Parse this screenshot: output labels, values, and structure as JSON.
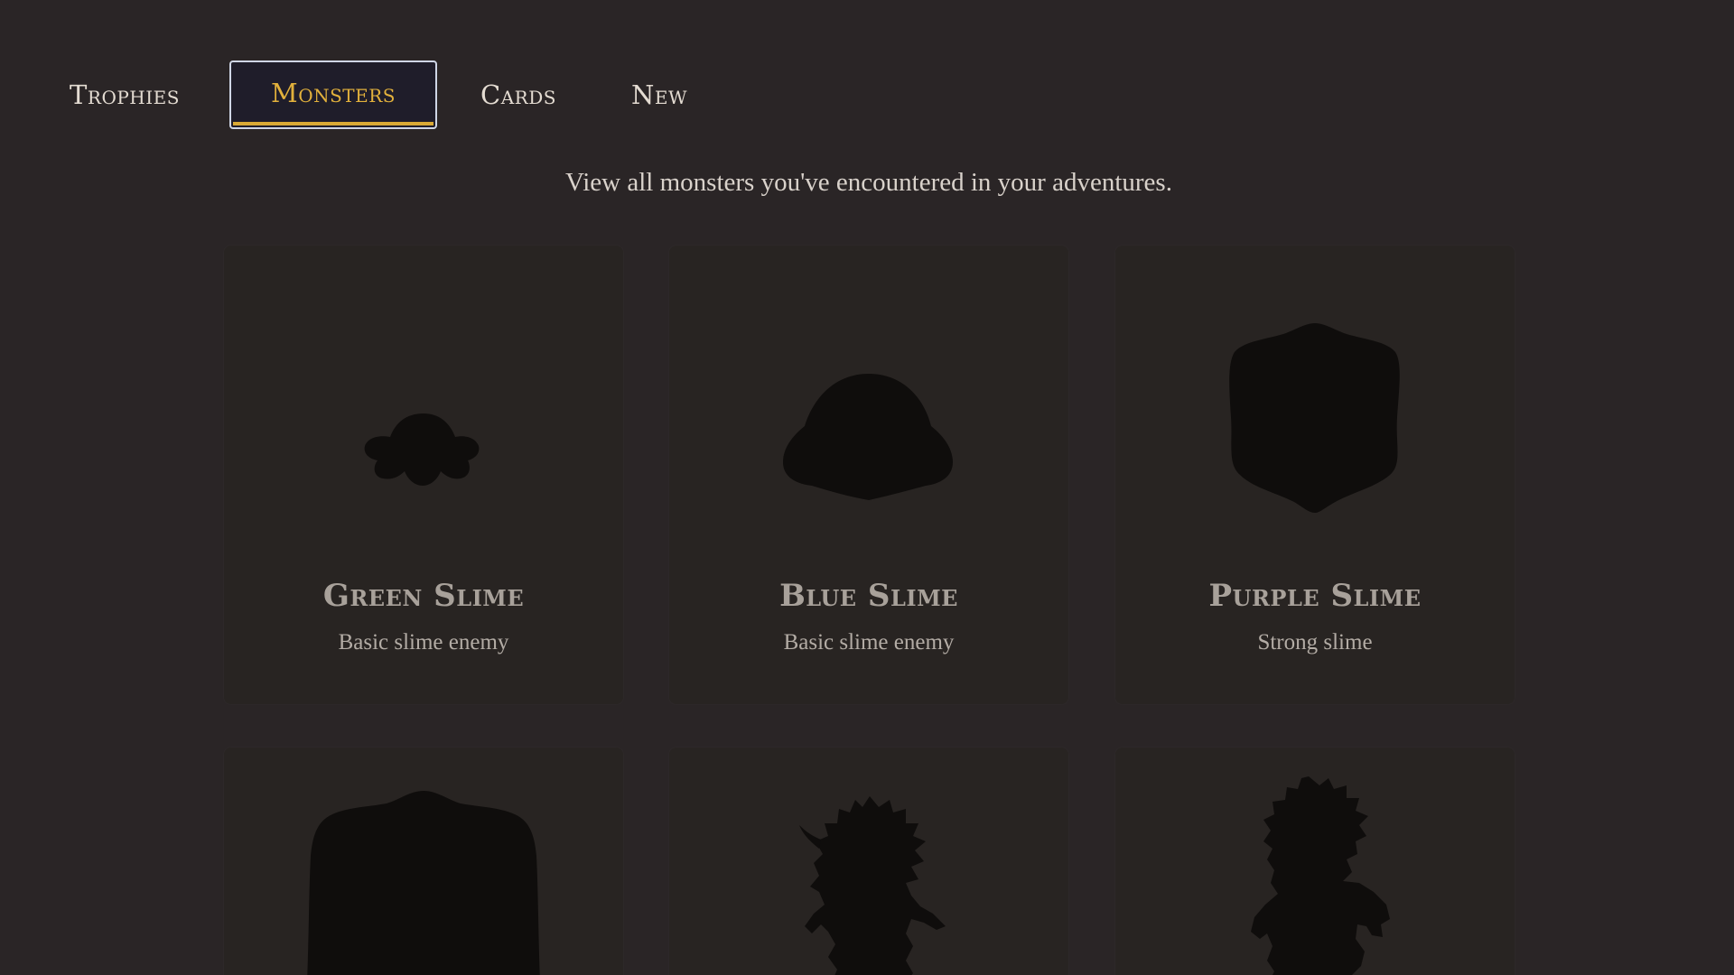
{
  "tabs": [
    {
      "label": "Trophies",
      "active": false
    },
    {
      "label": "Monsters",
      "active": true
    },
    {
      "label": "Cards",
      "active": false
    },
    {
      "label": "New",
      "active": false
    }
  ],
  "subtitle": "View all monsters you've encountered in your adventures.",
  "monsters": [
    {
      "name": "Green Slime",
      "description": "Basic slime enemy",
      "silhouette": "small-slime-icon"
    },
    {
      "name": "Blue Slime",
      "description": "Basic slime enemy",
      "silhouette": "round-slime-icon"
    },
    {
      "name": "Purple Slime",
      "description": "Strong slime",
      "silhouette": "cube-slime-icon"
    },
    {
      "name": "",
      "description": "",
      "silhouette": "large-slime-icon"
    },
    {
      "name": "",
      "description": "",
      "silhouette": "plant-creature-icon"
    },
    {
      "name": "",
      "description": "",
      "silhouette": "beast-creature-icon"
    }
  ],
  "colors": {
    "background": "#2a2526",
    "card": "#282422",
    "silhouette": "#0f0d0c",
    "active_tab_text": "#e2b13c",
    "active_tab_border": "#cfd6e6",
    "active_tab_underline": "#d9a935",
    "tab_text": "#e4dcd2"
  }
}
